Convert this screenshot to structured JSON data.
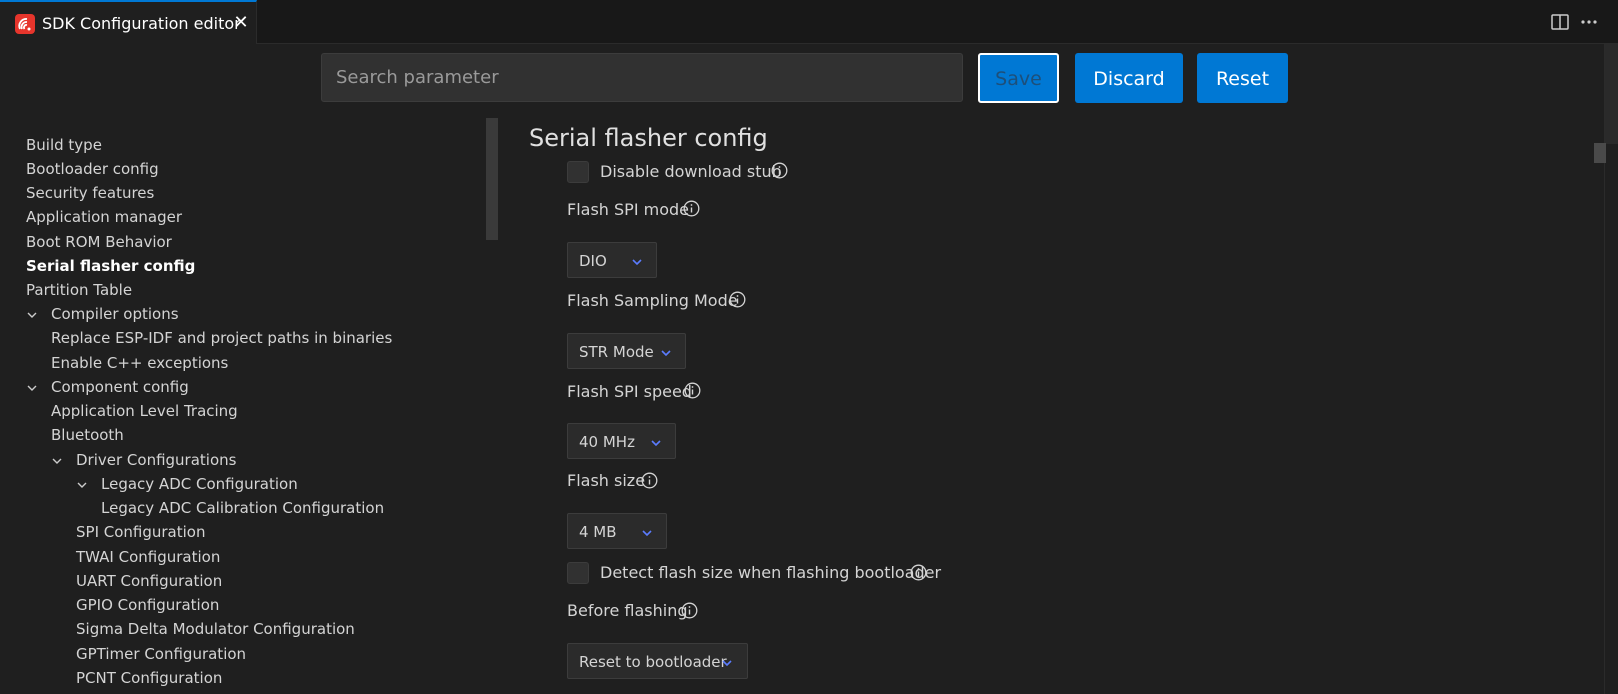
{
  "tab": {
    "title": "SDK Configuration editor",
    "close_icon": "close-icon",
    "brand_color": "#e7352c"
  },
  "toolbar": {
    "search_placeholder": "Search parameter",
    "save_label": "Save",
    "discard_label": "Discard",
    "reset_label": "Reset",
    "accent_color": "#0078d4"
  },
  "sidebar": {
    "items": [
      {
        "label": "Build type"
      },
      {
        "label": "Bootloader config"
      },
      {
        "label": "Security features"
      },
      {
        "label": "Application manager"
      },
      {
        "label": "Boot ROM Behavior"
      },
      {
        "label": "Serial flasher config",
        "active": true
      },
      {
        "label": "Partition Table"
      },
      {
        "label": "Compiler options",
        "expanded": true
      },
      {
        "label": "Replace ESP-IDF and project paths in binaries"
      },
      {
        "label": "Enable C++ exceptions"
      },
      {
        "label": "Component config",
        "expanded": true
      },
      {
        "label": "Application Level Tracing"
      },
      {
        "label": "Bluetooth"
      },
      {
        "label": "Driver Configurations",
        "expanded": true
      },
      {
        "label": "Legacy ADC Configuration",
        "expanded": true
      },
      {
        "label": "Legacy ADC Calibration Configuration"
      },
      {
        "label": "SPI Configuration"
      },
      {
        "label": "TWAI Configuration"
      },
      {
        "label": "UART Configuration"
      },
      {
        "label": "GPIO Configuration"
      },
      {
        "label": "Sigma Delta Modulator Configuration"
      },
      {
        "label": "GPTimer Configuration"
      },
      {
        "label": "PCNT Configuration"
      }
    ]
  },
  "main": {
    "section_title": "Serial flasher config",
    "disable_download_stub": {
      "label": "Disable download stub",
      "checked": false
    },
    "flash_spi_mode": {
      "label": "Flash SPI mode",
      "value": "DIO"
    },
    "flash_sampling_mode": {
      "label": "Flash Sampling Mode",
      "value": "STR Mode"
    },
    "flash_spi_speed": {
      "label": "Flash SPI speed",
      "value": "40 MHz"
    },
    "flash_size": {
      "label": "Flash size",
      "value": "4 MB"
    },
    "detect_flash_size": {
      "label": "Detect flash size when flashing bootloader",
      "checked": false
    },
    "before_flashing": {
      "label": "Before flashing",
      "value": "Reset to bootloader"
    }
  }
}
